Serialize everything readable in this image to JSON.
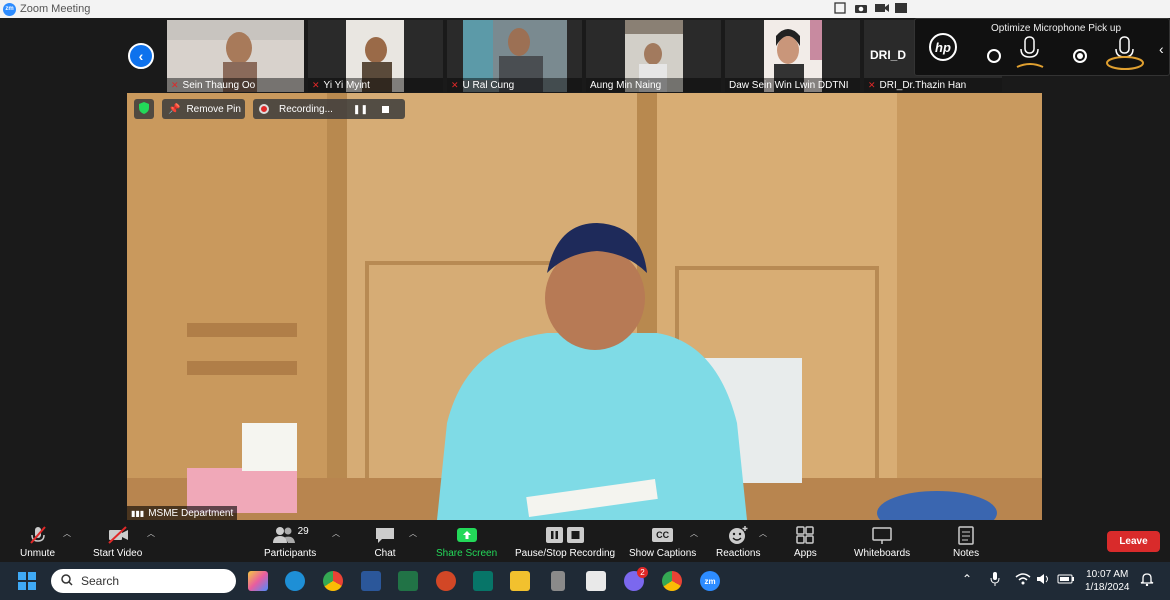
{
  "window": {
    "title": "Zoom Meeting",
    "logo_text": "zm"
  },
  "thumbnails": [
    {
      "name": "Sein Thaung Oo",
      "muted": true
    },
    {
      "name": "Yi Yi Myint",
      "muted": true
    },
    {
      "name": "U Ral Cung",
      "muted": true
    },
    {
      "name": "Aung Min Naing",
      "muted": false
    },
    {
      "name": "Daw Sein Win Lwin DDTNI",
      "muted": false
    },
    {
      "name": "DRI_Dr.Thazin Han",
      "muted": true
    }
  ],
  "partial_name": "DRI_D",
  "hp_popup": {
    "title": "Optimize Microphone Pick up",
    "logo": "hp"
  },
  "main_video": {
    "remove_pin": "Remove Pin",
    "recording": "Recording...",
    "label": "MSME Department"
  },
  "toolbar": {
    "unmute": "Unmute",
    "start_video": "Start Video",
    "participants": "Participants",
    "participants_count": "29",
    "chat": "Chat",
    "share_screen": "Share Screen",
    "pause_stop": "Pause/Stop Recording",
    "captions": "Show Captions",
    "cc": "CC",
    "reactions": "Reactions",
    "apps": "Apps",
    "whiteboards": "Whiteboards",
    "notes": "Notes",
    "leave": "Leave"
  },
  "taskbar": {
    "search": "Search",
    "notification_count": "2",
    "time": "10:07 AM",
    "date": "1/18/2024"
  },
  "colors": {
    "accent": "#0e72ed",
    "leave": "#d92b2b",
    "share": "#23d959"
  }
}
